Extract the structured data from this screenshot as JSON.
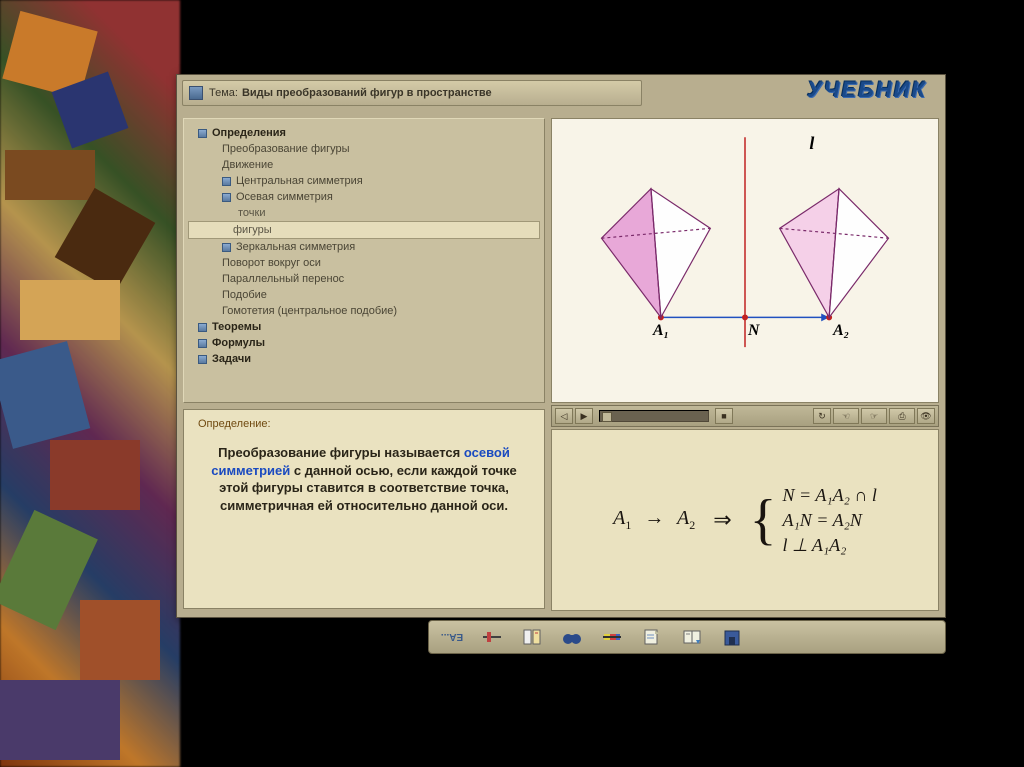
{
  "brand": "УЧЕБНИК",
  "topic": {
    "label": "Тема:",
    "title": "Виды преобразований фигур в пространстве"
  },
  "nav": {
    "items": [
      {
        "label": "Определения",
        "level": 1,
        "icon": true
      },
      {
        "label": "Преобразование фигуры",
        "level": 2
      },
      {
        "label": "Движение",
        "level": 2
      },
      {
        "label": "Центральная симметрия",
        "level": 2,
        "icon": true
      },
      {
        "label": "Осевая симметрия",
        "level": 2,
        "icon": true
      },
      {
        "label": "точки",
        "level": 3
      },
      {
        "label": "фигуры",
        "level": 3,
        "active": true
      },
      {
        "label": "Зеркальная симметрия",
        "level": 2,
        "icon": true
      },
      {
        "label": "Поворот вокруг оси",
        "level": 2
      },
      {
        "label": "Параллельный перенос",
        "level": 2
      },
      {
        "label": "Подобие",
        "level": 2
      },
      {
        "label": "Гомотетия (центральное подобие)",
        "level": 2
      },
      {
        "label": "Теоремы",
        "level": 1,
        "icon": true
      },
      {
        "label": "Формулы",
        "level": 1,
        "icon": true
      },
      {
        "label": "Задачи",
        "level": 1,
        "icon": true
      }
    ]
  },
  "definition": {
    "header": "Определение:",
    "pre": "Преобразование фигуры называется ",
    "keyword": "осевой симметрией",
    "post": " с данной осью, если каждой точке этой фигуры ставится в соответствие точка, симметричная ей относительно данной оси."
  },
  "figure": {
    "axis_label": "l",
    "point_a1": "A₁",
    "point_n": "N",
    "point_a2": "A₂"
  },
  "formula": {
    "lhs_a1": "A",
    "lhs_sub1": "1",
    "arrow": "→",
    "lhs_a2": "A",
    "lhs_sub2": "2",
    "implies": "⇒",
    "row1": "N = A₁A₂ ∩ l",
    "row2": "A₁N = A₂N",
    "row3": "l ⊥ A₁A₂"
  },
  "media_toolbar": {
    "sound": "◁",
    "play": "▶",
    "stop": "■",
    "loop": "↻",
    "hand1": "☜",
    "hand2": "☞",
    "print": "⎙",
    "eye": "👁"
  },
  "bottom_bar": {
    "ea": "EA...",
    "slider_icon": "slider",
    "notes_icon": "notes",
    "binoculars_icon": "binoculars",
    "flag_icon": "flag",
    "book_icon": "book",
    "pages_icon": "pages",
    "home_icon": "home"
  }
}
